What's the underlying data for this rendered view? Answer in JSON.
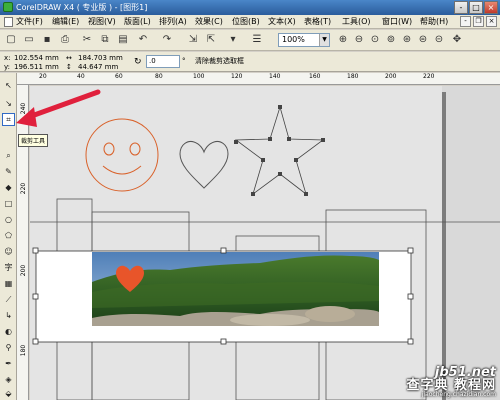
{
  "window": {
    "title": "CorelDRAW X4 ( 专业版 ) - [图形1]",
    "min": "-",
    "max": "□",
    "close": "×"
  },
  "menubar": {
    "items": [
      "文件(F)",
      "编辑(E)",
      "视图(V)",
      "版面(L)",
      "排列(A)",
      "效果(C)",
      "位图(B)",
      "文本(X)",
      "表格(T)",
      "工具(O)",
      "窗口(W)",
      "帮助(H)"
    ],
    "mdi_min": "-",
    "mdi_restore": "❐",
    "mdi_close": "×"
  },
  "toolbar": {
    "zoom": "100%"
  },
  "propbar": {
    "x_label": "x:",
    "x_value": "102.554 mm",
    "y_label": "y:",
    "y_value": "196.511 mm",
    "w_value": "184.703 mm",
    "h_value": "44.647 mm",
    "angle_value": ".0",
    "angle_unit": "°",
    "clear_clip": "清除裁剪选取框"
  },
  "ruler": {
    "h_ticks": [
      "20",
      "40",
      "60",
      "80",
      "100",
      "120",
      "140",
      "160",
      "180",
      "200",
      "220"
    ],
    "v_ticks": [
      "240",
      "220",
      "200",
      "180"
    ]
  },
  "tooltip": "裁剪工具",
  "watermark": {
    "site": "jb51.net",
    "cn": "查字典 教程网",
    "sub": "jiaocheng.chazidian.com"
  },
  "colors": {
    "accent_orange": "#e8552a",
    "title_blue": "#2a5c9c",
    "selection_blue": "#316ac5"
  },
  "icons": [
    "pick-tool-icon",
    "shape-tool-icon",
    "crop-tool-icon",
    "zoom-tool-icon",
    "freehand-tool-icon",
    "smart-fill-icon",
    "rectangle-tool-icon",
    "ellipse-tool-icon",
    "polygon-tool-icon",
    "basic-shapes-icon",
    "text-tool-icon",
    "table-tool-icon",
    "parallel-dimension-icon",
    "connector-tool-icon",
    "blend-tool-icon",
    "eyedropper-tool-icon",
    "outline-tool-icon",
    "fill-tool-icon",
    "interactive-fill-icon"
  ]
}
